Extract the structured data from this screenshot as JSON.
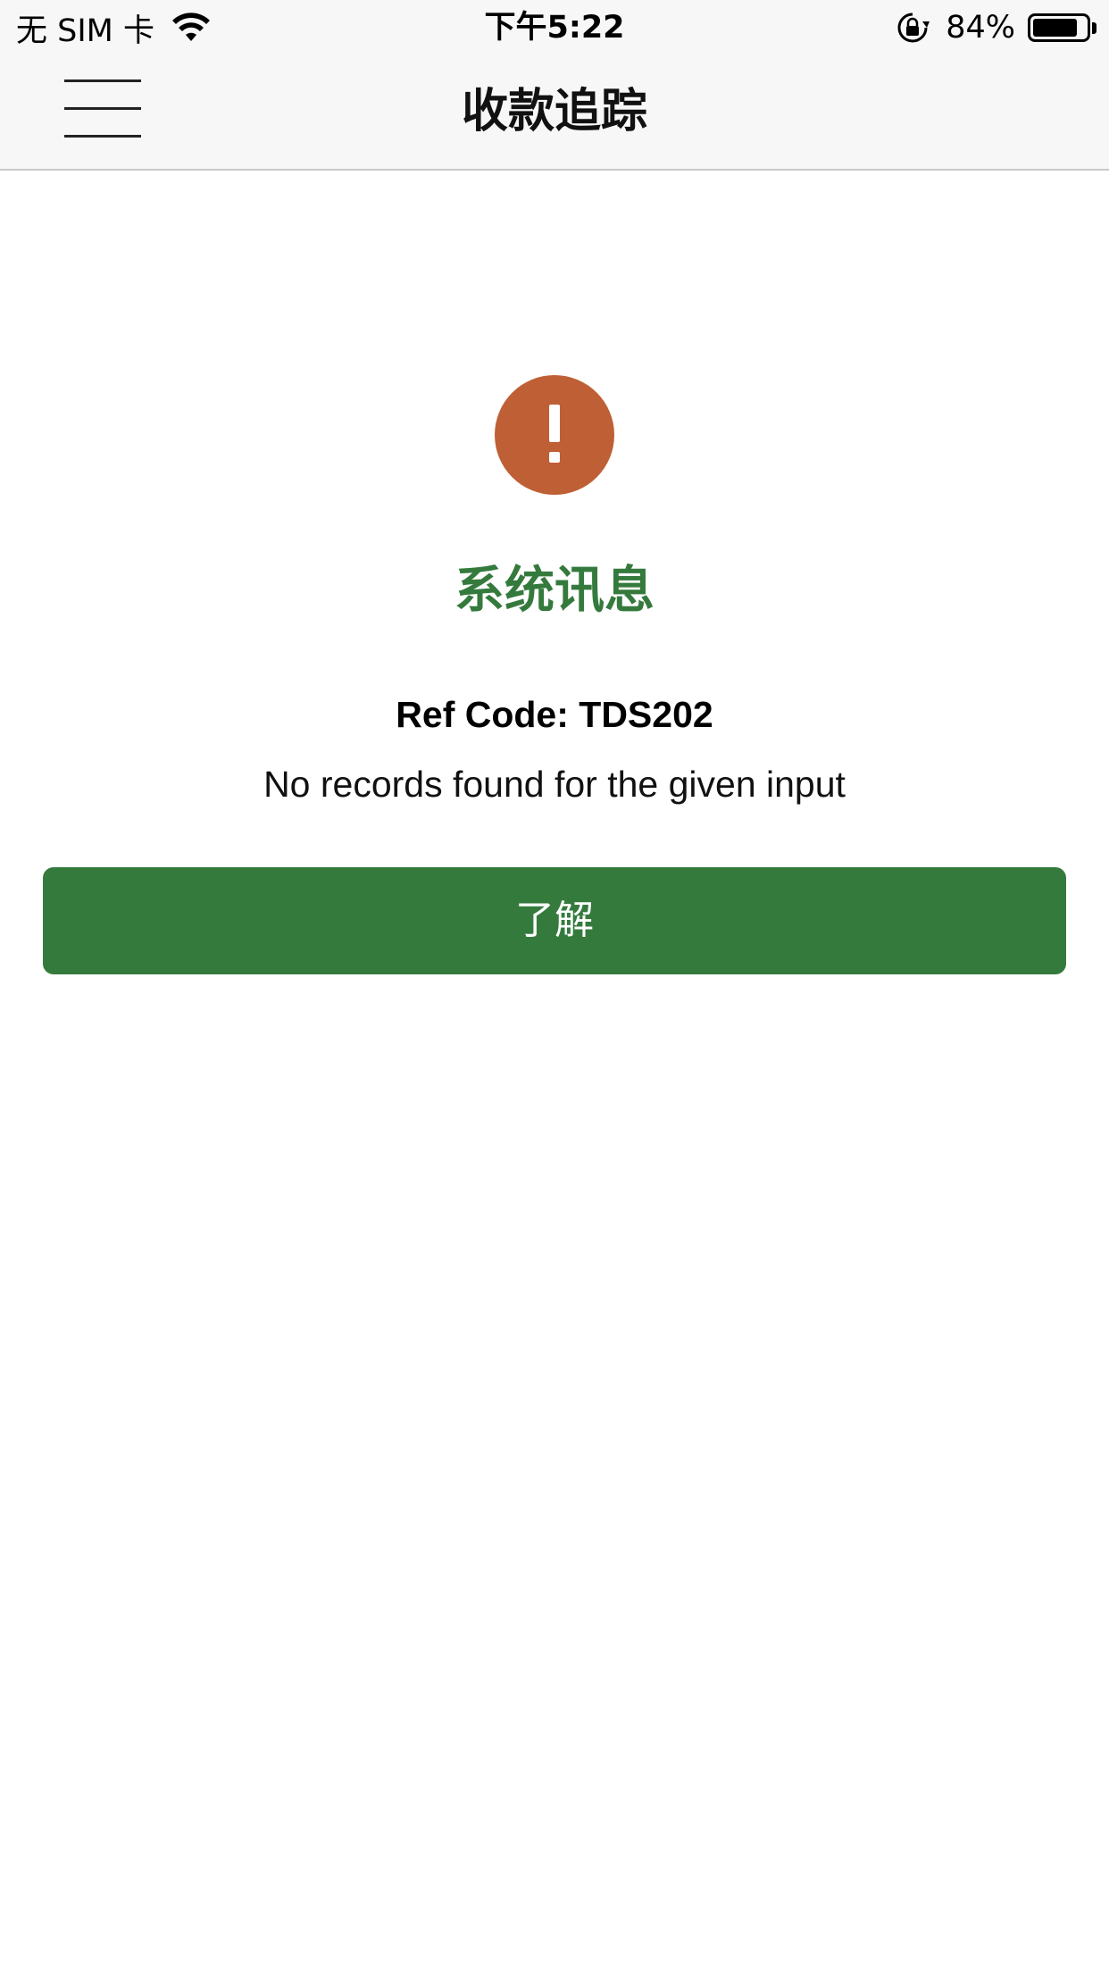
{
  "status_bar": {
    "carrier": "无 SIM 卡",
    "time": "下午5:22",
    "battery_percent_label": "84%",
    "battery_level": 0.84,
    "icons": [
      "wifi-icon",
      "rotation-lock-icon",
      "battery-icon"
    ]
  },
  "nav": {
    "title": "收款追踪",
    "menu_icon": "hamburger-menu-icon"
  },
  "dialog": {
    "icon": "exclamation-icon",
    "icon_color": "#bf5f35",
    "title": "系统讯息",
    "title_color": "#357a3d",
    "ref_code": "Ref Code: TDS202",
    "message": "No records found for the given input",
    "confirm_label": "了解",
    "confirm_color": "#357a3d"
  }
}
